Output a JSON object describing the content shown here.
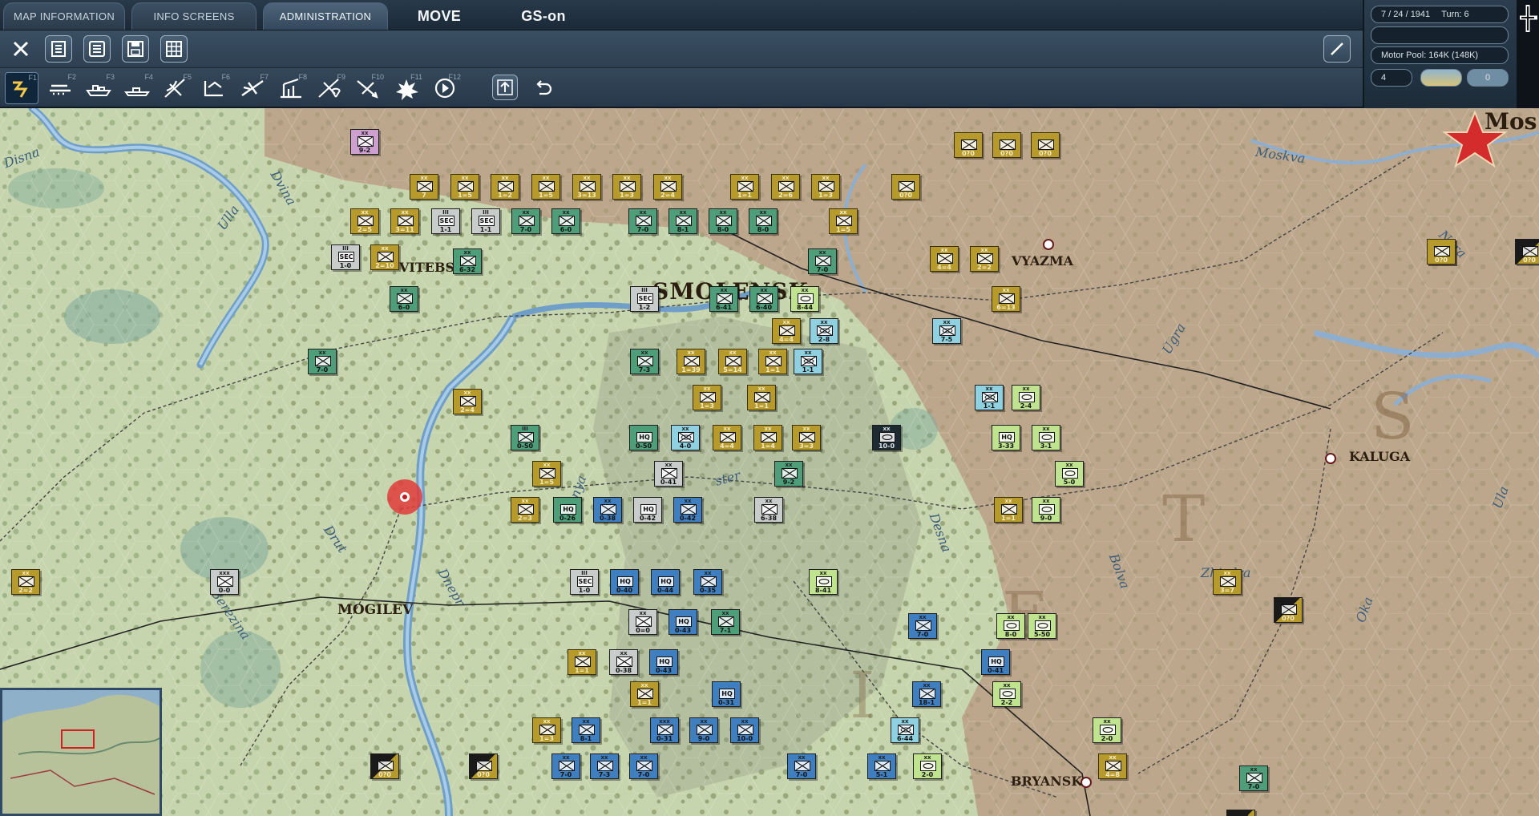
{
  "tabs": [
    {
      "label": "MAP INFORMATION"
    },
    {
      "label": "INFO SCREENS"
    },
    {
      "label": "ADMINISTRATION"
    },
    {
      "label": "MOVE"
    },
    {
      "label": "GS-on"
    }
  ],
  "status": {
    "date": "7 / 24 / 1941",
    "turn": "Turn: 6",
    "motor_pool": "Motor Pool:  164K (148K)",
    "counter_a": "4",
    "counter_b": "0"
  },
  "toolbar1": {
    "icons": [
      "close-icon",
      "unit-list-icon",
      "list-icon",
      "save-icon",
      "grid-icon",
      "pencil-icon"
    ]
  },
  "toolbar2": {
    "fkeys": [
      "F1",
      "F2",
      "F3",
      "F4",
      "F5",
      "F6",
      "F7",
      "F8",
      "F9",
      "F10",
      "F11",
      "F12"
    ]
  },
  "cities": {
    "smolensk": "SMOLENSK",
    "vitebsk": "VITEBS",
    "vyazma": "VYAZMA",
    "kaluga": "KALUGA",
    "mogilev": "MOGILEV",
    "bryansk": "BRYANSK",
    "moscow": "Mos"
  },
  "rivers": {
    "disna": "Disna",
    "dvina": "Dvina",
    "ulla": "Ulla",
    "moskva": "Moskva",
    "nara": "Nara",
    "ugra": "Ugra",
    "drut": "Drut",
    "dnepr": "Dnepr",
    "berezina": "Berezina",
    "desna": "Desna",
    "bolva": "Bolva",
    "zhizdra": "Zhizdra",
    "oka": "Oka",
    "ula": "Ula",
    "pronya": "Pronya",
    "sozh": "ster"
  },
  "units": [
    {
      "type": "u-pink",
      "ech": "xx",
      "val": "9-2"
    },
    {
      "type": "u-axis",
      "ech": "xx",
      "val": "7"
    },
    {
      "type": "u-axis",
      "ech": "xx",
      "val": "1=5"
    },
    {
      "type": "u-axis",
      "ech": "xx",
      "val": "1=2"
    },
    {
      "type": "u-axis",
      "ech": "xx",
      "val": "1=5"
    },
    {
      "type": "u-axis",
      "ech": "xx",
      "val": "3=13"
    },
    {
      "type": "u-axis",
      "ech": "xx",
      "val": "1=3"
    },
    {
      "type": "u-axis",
      "ech": "xx",
      "val": "2=4"
    },
    {
      "type": "u-axis",
      "ech": "xx",
      "val": "1=1"
    },
    {
      "type": "u-axis",
      "ech": "xx",
      "val": "2=6"
    },
    {
      "type": "u-axis",
      "ech": "xx",
      "val": "1=3"
    },
    {
      "type": "u-axis",
      "ech": "",
      "val": "0?0"
    },
    {
      "type": "u-axis",
      "ech": "xx",
      "val": "2=5"
    },
    {
      "type": "u-axis",
      "ech": "xx",
      "val": "3=11"
    },
    {
      "type": "u-sov",
      "ech": "III",
      "val": "1-1",
      "sec": "SEC"
    },
    {
      "type": "u-sov",
      "ech": "III",
      "val": "1-1",
      "sec": "SEC"
    },
    {
      "type": "u-sovg",
      "ech": "xx",
      "val": "7-0"
    },
    {
      "type": "u-sovg",
      "ech": "xx",
      "val": "6-0"
    },
    {
      "type": "u-sovg",
      "ech": "xx",
      "val": "7-0"
    },
    {
      "type": "u-sovg",
      "ech": "xx",
      "val": "8-1"
    },
    {
      "type": "u-sovg",
      "ech": "xx",
      "val": "8-0"
    },
    {
      "type": "u-sovg",
      "ech": "xx",
      "val": "8-0"
    },
    {
      "type": "u-axis",
      "ech": "xx",
      "val": "1=5"
    },
    {
      "type": "u-sov",
      "ech": "III",
      "val": "1-0",
      "sec": "SEC"
    },
    {
      "type": "u-axis",
      "ech": "xx",
      "val": "2=10"
    },
    {
      "type": "u-sovg",
      "ech": "xx",
      "val": "6-32"
    },
    {
      "type": "u-axis",
      "ech": "",
      "val": "0?0"
    },
    {
      "type": "u-axis",
      "ech": "",
      "val": "0?0"
    },
    {
      "type": "u-axis",
      "ech": "",
      "val": "0?0"
    },
    {
      "type": "u-axis",
      "ech": "xx",
      "val": "4=4"
    },
    {
      "type": "u-axis",
      "ech": "xx",
      "val": "2=2"
    },
    {
      "type": "u-axis",
      "ech": "xx",
      "val": "6=13"
    },
    {
      "type": "u-sovg",
      "ech": "xx",
      "val": "6-0"
    },
    {
      "type": "u-sov",
      "ech": "III",
      "val": "1-2",
      "sec": "SEC"
    },
    {
      "type": "u-sovg",
      "ech": "xx",
      "val": "6-41"
    },
    {
      "type": "u-sovg",
      "ech": "xx",
      "val": "6-40"
    },
    {
      "type": "u-lime",
      "ech": "xx",
      "val": "8-44"
    },
    {
      "type": "u-sovg",
      "ech": "xx",
      "val": "7-0"
    },
    {
      "type": "u-axis",
      "ech": "xx",
      "val": "4=4"
    },
    {
      "type": "u-sovc",
      "ech": "xx",
      "val": "2-8"
    },
    {
      "type": "u-sovc",
      "ech": "xx",
      "val": "7-5"
    },
    {
      "type": "u-sovg",
      "ech": "xx",
      "val": "7-0"
    },
    {
      "type": "u-sovg",
      "ech": "xx",
      "val": "7-3"
    },
    {
      "type": "u-axis",
      "ech": "xx",
      "val": "1=39"
    },
    {
      "type": "u-axis",
      "ech": "xx",
      "val": "5=14"
    },
    {
      "type": "u-axis",
      "ech": "xx",
      "val": "1=1"
    },
    {
      "type": "u-sovc",
      "ech": "xx",
      "val": "1-1"
    },
    {
      "type": "u-axis",
      "ech": "xx",
      "val": "1=3"
    },
    {
      "type": "u-axis",
      "ech": "xx",
      "val": "1=1"
    },
    {
      "type": "u-sovc",
      "ech": "xx",
      "val": "1-1"
    },
    {
      "type": "u-lime",
      "ech": "xx",
      "val": "2-4"
    },
    {
      "type": "u-axis",
      "ech": "xx",
      "val": "2=4"
    },
    {
      "type": "u-sovg",
      "ech": "III",
      "val": "0-50"
    },
    {
      "type": "u-sovg",
      "ech": "",
      "val": "0-50",
      "hq": "HQ"
    },
    {
      "type": "u-sovc",
      "ech": "xx",
      "val": "4-0"
    },
    {
      "type": "u-axis",
      "ech": "xx",
      "val": "4=4"
    },
    {
      "type": "u-axis",
      "ech": "xx",
      "val": "1=4"
    },
    {
      "type": "u-axis",
      "ech": "xx",
      "val": "3=3"
    },
    {
      "type": "u-dark",
      "ech": "xx",
      "val": "10-0"
    },
    {
      "type": "u-lime",
      "ech": "",
      "val": "3-33",
      "hq": "HQ"
    },
    {
      "type": "u-lime",
      "ech": "xx",
      "val": "3-1"
    },
    {
      "type": "u-axis",
      "ech": "xx",
      "val": "1=5"
    },
    {
      "type": "u-sov",
      "ech": "xx",
      "val": "0-41"
    },
    {
      "type": "u-sovg",
      "ech": "xx",
      "val": "9-2"
    },
    {
      "type": "u-lime",
      "ech": "xx",
      "val": "5-0"
    },
    {
      "type": "u-axis",
      "ech": "xx",
      "val": "2=3"
    },
    {
      "type": "u-sovg",
      "ech": "",
      "val": "0-26",
      "hq": "HQ"
    },
    {
      "type": "u-soviet-b",
      "ech": "xx",
      "val": "0-38"
    },
    {
      "type": "u-sov",
      "ech": "",
      "val": "0-42",
      "hq": "HQ"
    },
    {
      "type": "u-soviet-b",
      "ech": "xx",
      "val": "0-42"
    },
    {
      "type": "u-sov",
      "ech": "xx",
      "val": "6-38"
    },
    {
      "type": "u-axis",
      "ech": "xx",
      "val": "1=1"
    },
    {
      "type": "u-lime",
      "ech": "xx",
      "val": "9-0"
    },
    {
      "type": "u-axis",
      "ech": "xx",
      "val": "2=2"
    },
    {
      "type": "u-sov",
      "ech": "xxx",
      "val": "0-0"
    },
    {
      "type": "u-sov",
      "ech": "III",
      "val": "1-0",
      "sec": "SEC"
    },
    {
      "type": "u-soviet-b",
      "ech": "",
      "val": "0-40",
      "hq": "HQ"
    },
    {
      "type": "u-soviet-b",
      "ech": "",
      "val": "0-44",
      "hq": "HQ"
    },
    {
      "type": "u-soviet-b",
      "ech": "xx",
      "val": "0-35"
    },
    {
      "type": "u-lime",
      "ech": "xx",
      "val": "8-41"
    },
    {
      "type": "u-axis",
      "ech": "xx",
      "val": "3=7"
    },
    {
      "type": "u-ss",
      "ech": "",
      "val": "0?0"
    },
    {
      "type": "u-sov",
      "ech": "xx",
      "val": "0=0"
    },
    {
      "type": "u-soviet-b",
      "ech": "",
      "val": "0-43",
      "hq": "HQ"
    },
    {
      "type": "u-sovg",
      "ech": "xx",
      "val": "7-1"
    },
    {
      "type": "u-soviet-b",
      "ech": "xx",
      "val": "7-0"
    },
    {
      "type": "u-lime",
      "ech": "xx",
      "val": "8-0"
    },
    {
      "type": "u-lime",
      "ech": "xx",
      "val": "5-50"
    },
    {
      "type": "u-axis",
      "ech": "xx",
      "val": "1=1"
    },
    {
      "type": "u-sov",
      "ech": "xx",
      "val": "0-38"
    },
    {
      "type": "u-soviet-b",
      "ech": "",
      "val": "0-43",
      "hq": "HQ"
    },
    {
      "type": "u-soviet-b",
      "ech": "",
      "val": "0-41",
      "hq": "HQ"
    },
    {
      "type": "u-axis",
      "ech": "xx",
      "val": "1=1"
    },
    {
      "type": "u-soviet-b",
      "ech": "",
      "val": "0-31",
      "hq": "HQ"
    },
    {
      "type": "u-soviet-b",
      "ech": "xx",
      "val": "18-1"
    },
    {
      "type": "u-lime",
      "ech": "xx",
      "val": "2-2"
    },
    {
      "type": "u-axis",
      "ech": "xx",
      "val": "1=3"
    },
    {
      "type": "u-soviet-b",
      "ech": "xx",
      "val": "8-1"
    },
    {
      "type": "u-soviet-b",
      "ech": "xxx",
      "val": "0-31"
    },
    {
      "type": "u-soviet-b",
      "ech": "xx",
      "val": "9-0"
    },
    {
      "type": "u-soviet-b",
      "ech": "xx",
      "val": "10-0"
    },
    {
      "type": "u-sovc",
      "ech": "xx",
      "val": "6-44"
    },
    {
      "type": "u-lime",
      "ech": "xx",
      "val": "2-0"
    },
    {
      "type": "u-ss",
      "ech": "",
      "val": "0?0"
    },
    {
      "type": "u-soviet-b",
      "ech": "xx",
      "val": "7-0"
    },
    {
      "type": "u-soviet-b",
      "ech": "xx",
      "val": "7-3"
    },
    {
      "type": "u-soviet-b",
      "ech": "xx",
      "val": "7-0"
    },
    {
      "type": "u-soviet-b",
      "ech": "xx",
      "val": "7-0"
    },
    {
      "type": "u-soviet-b",
      "ech": "xx",
      "val": "5-1"
    },
    {
      "type": "u-lime",
      "ech": "xx",
      "val": "2-0"
    },
    {
      "type": "u-axis",
      "ech": "xx",
      "val": "4=8"
    },
    {
      "type": "u-ss",
      "ech": "",
      "val": "0?0"
    },
    {
      "type": "u-sovg",
      "ech": "xx",
      "val": "7-0"
    },
    {
      "type": "u-ss",
      "ech": "",
      "val": "0?0"
    },
    {
      "type": "u-ss",
      "ech": "",
      "val": "0?0"
    },
    {
      "type": "u-ss",
      "ech": "",
      "val": "0=0"
    },
    {
      "type": "u-axis",
      "ech": "",
      "val": "0?0"
    }
  ],
  "colors": {
    "axis": "#b79a2c",
    "soviet_green": "#4e9e7a",
    "soviet_blue": "#3f7fc0",
    "terrain_light": "#c9d7ae",
    "terrain_brown": "#b79d83"
  }
}
